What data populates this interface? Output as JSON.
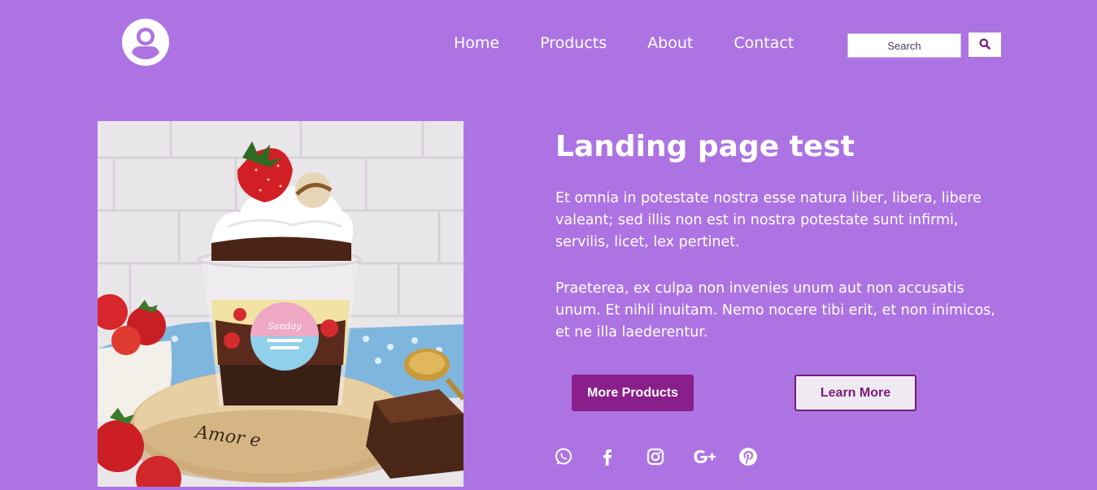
{
  "header": {
    "logo_icon": "user-circle-icon",
    "nav": [
      "Home",
      "Products",
      "About",
      "Contact"
    ],
    "search": {
      "placeholder": "Search",
      "button_icon": "search-icon"
    }
  },
  "hero": {
    "image_alt": "dessert-cup-image",
    "image_text": "Sanday",
    "board_text": "Amor e",
    "title": "Landing page test",
    "paragraphs": [
      "Et omnia in potestate nostra esse natura liber, libera, libere valeant; sed illis non est in nostra potestate sunt infirmi, servilis, licet, lex pertinet.",
      "Praeterea, ex culpa non invenies unum aut non accusatis unum. Et nihil inuitam. Nemo nocere tibi erit, et non inimicos, et ne illa laederentur."
    ],
    "buttons": {
      "primary": "More Products",
      "secondary": "Learn More"
    }
  },
  "social": [
    "whatsapp-icon",
    "facebook-icon",
    "instagram-icon",
    "google-plus-icon",
    "pinterest-icon"
  ],
  "colors": {
    "background": "#ad73e3",
    "primary_button": "#8a1e8a",
    "text": "#ffffff"
  }
}
